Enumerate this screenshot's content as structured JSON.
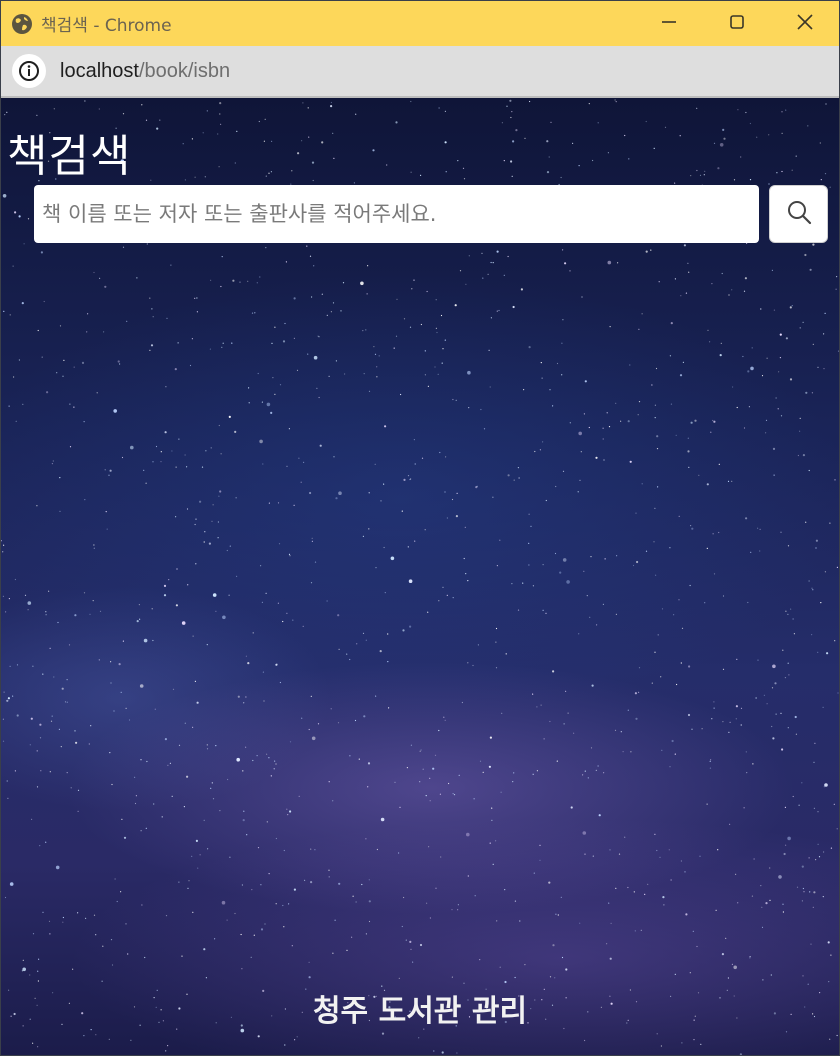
{
  "window": {
    "title": "책검색 - Chrome",
    "controls": {
      "minimize_icon": "minimize-icon",
      "maximize_icon": "maximize-icon",
      "close_icon": "close-icon"
    },
    "titlebar_color": "#fdd75a"
  },
  "addressbar": {
    "host": "localhost",
    "path": "/book/isbn",
    "info_icon": "info-icon"
  },
  "page": {
    "heading": "책검색",
    "search": {
      "placeholder": "책 이름 또는 저자 또는 출판사를 적어주세요.",
      "value": "",
      "button_icon": "search-icon"
    },
    "footer": "청주 도서관 관리",
    "background": "starry night sky (milky way)"
  }
}
